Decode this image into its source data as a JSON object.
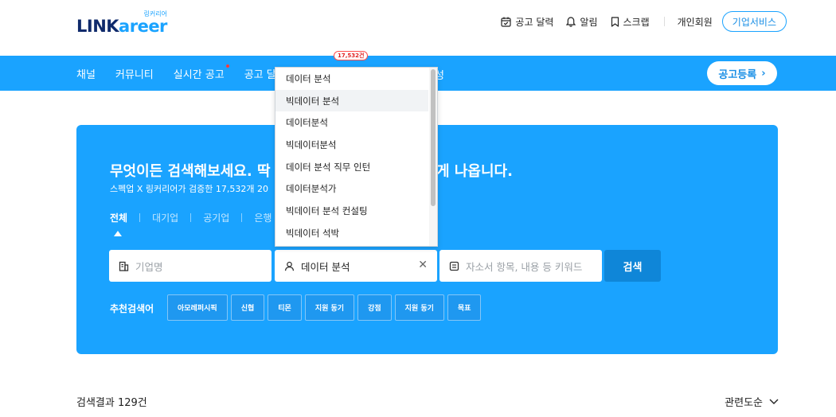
{
  "header": {
    "logo_sub": "링커리어",
    "logo_link": "LINK",
    "logo_areer": "areer",
    "calendar_label": "공고 달력",
    "alarm_label": "알림",
    "scrap_label": "스크랩",
    "member_label": "개인회원",
    "biz_button": "기업서비스"
  },
  "nav": {
    "items": [
      "채널",
      "커뮤니티",
      "실시간 공고",
      "공고 달력"
    ],
    "tail": "성",
    "post_button": "공고등록",
    "badge": "17,532건"
  },
  "hero": {
    "title_left": "무엇이든 검색해보세요. 딱",
    "title_right": "게 나옵니다.",
    "subtitle": "스펙업 X 링커리어가 검증한 17,532개 20",
    "tabs": [
      "전체",
      "대기업",
      "공기업",
      "은행"
    ],
    "active_tab": "전체",
    "company_placeholder": "기업명",
    "job_value": "데이터 분석",
    "keyword_placeholder": "자소서 항목, 내용 등 키워드",
    "search_button": "검색",
    "recommend_label": "추천검색어",
    "chips": [
      "아모레퍼시픽",
      "신협",
      "티몬",
      "지원 동기",
      "강점",
      "지원 동기",
      "목표"
    ]
  },
  "dropdown": {
    "items": [
      "데이터 분석",
      "빅데이터 분석",
      "데이터분석",
      "빅데이터분석",
      "데이터 분석 직무 인턴",
      "데이터분석가",
      "빅데이터 분석 컨설팅",
      "빅데이터 석박"
    ],
    "highlighted_index": 1
  },
  "results": {
    "count": "검색결과 129건",
    "sort": "관련도순"
  },
  "colors": {
    "brand_blue": "#1aa3ff",
    "navy": "#0f2a6b",
    "search_button": "#0f86d8",
    "badge_red": "#e02020"
  }
}
